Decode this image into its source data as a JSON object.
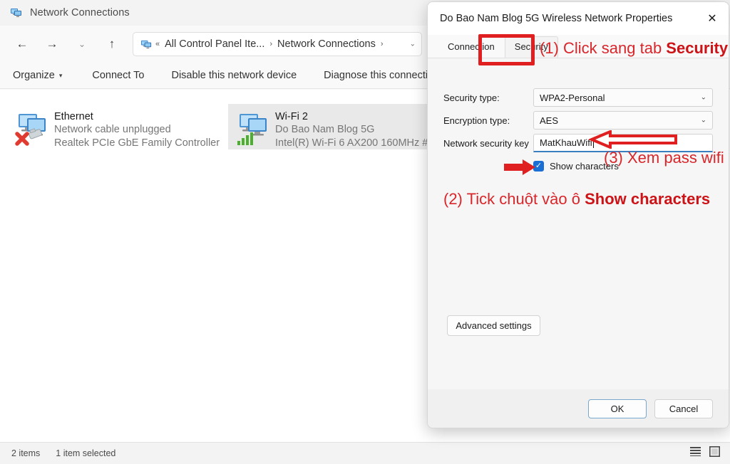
{
  "explorer": {
    "title": "Network Connections",
    "title_icon": "network-connections-icon",
    "window_controls": [
      {
        "name": "minimize",
        "glyph": "─"
      },
      {
        "name": "maximize",
        "glyph": "☐"
      },
      {
        "name": "close",
        "glyph": "✕"
      }
    ],
    "nav": {
      "back": "←",
      "forward": "→",
      "recent": "⌄",
      "up": "↑"
    },
    "address": {
      "icon": "control-panel-icon",
      "prefix": "«",
      "segments": [
        "All Control Panel Ite...",
        "Network Connections"
      ],
      "chevron": "›",
      "dropdown_caret": "⌄"
    },
    "commandbar": [
      {
        "label": "Organize",
        "caret": "▾"
      },
      {
        "label": "Connect To",
        "caret": ""
      },
      {
        "label": "Disable this network device",
        "caret": ""
      },
      {
        "label": "Diagnose this connection",
        "caret": ""
      }
    ],
    "connections": [
      {
        "name": "Ethernet",
        "line2": "Network cable unplugged",
        "line3": "Realtek PCIe GbE Family Controller",
        "selected": false,
        "badge": "error-x"
      },
      {
        "name": "Wi-Fi 2",
        "line2": "Do Bao Nam Blog 5G",
        "line3": "Intel(R) Wi-Fi 6 AX200 160MHz #",
        "selected": true,
        "badge": "signal-bars"
      }
    ],
    "status": {
      "items_count": "2 items",
      "selection": "1 item selected",
      "views": [
        {
          "name": "details-view-icon"
        },
        {
          "name": "large-icons-view-icon"
        }
      ]
    }
  },
  "dialog": {
    "title": "Do Bao Nam Blog 5G Wireless Network Properties",
    "close_glyph": "✕",
    "tabs": [
      {
        "label": "Connection",
        "active": false
      },
      {
        "label": "Security",
        "active": true
      }
    ],
    "fields": {
      "security_type": {
        "label": "Security type:",
        "value": "WPA2-Personal",
        "caret": "⌄"
      },
      "encryption_type": {
        "label": "Encryption type:",
        "value": "AES",
        "caret": "⌄"
      },
      "security_key": {
        "label": "Network security key",
        "value": "MatKhauWifi"
      },
      "show_characters": {
        "label": "Show characters",
        "checked": true,
        "check_glyph": "✓"
      }
    },
    "advanced_button": "Advanced settings",
    "footer": {
      "ok": "OK",
      "cancel": "Cancel"
    }
  },
  "annotations": {
    "accent_color": "#d9262b",
    "step1": {
      "prefix": "(1) ",
      "text": "Click sang tab ",
      "bold": "Security"
    },
    "step2": {
      "prefix": "(2) ",
      "text": "Tick chuột vào ô ",
      "bold": "Show characters"
    },
    "step3": {
      "text": "(3) Xem pass wifi"
    },
    "highlight_box": "security-tab-highlight",
    "arrows": [
      {
        "name": "arrow-to-security-key",
        "style": "hollow-left"
      },
      {
        "name": "arrow-to-show-characters",
        "style": "solid-right"
      }
    ]
  }
}
